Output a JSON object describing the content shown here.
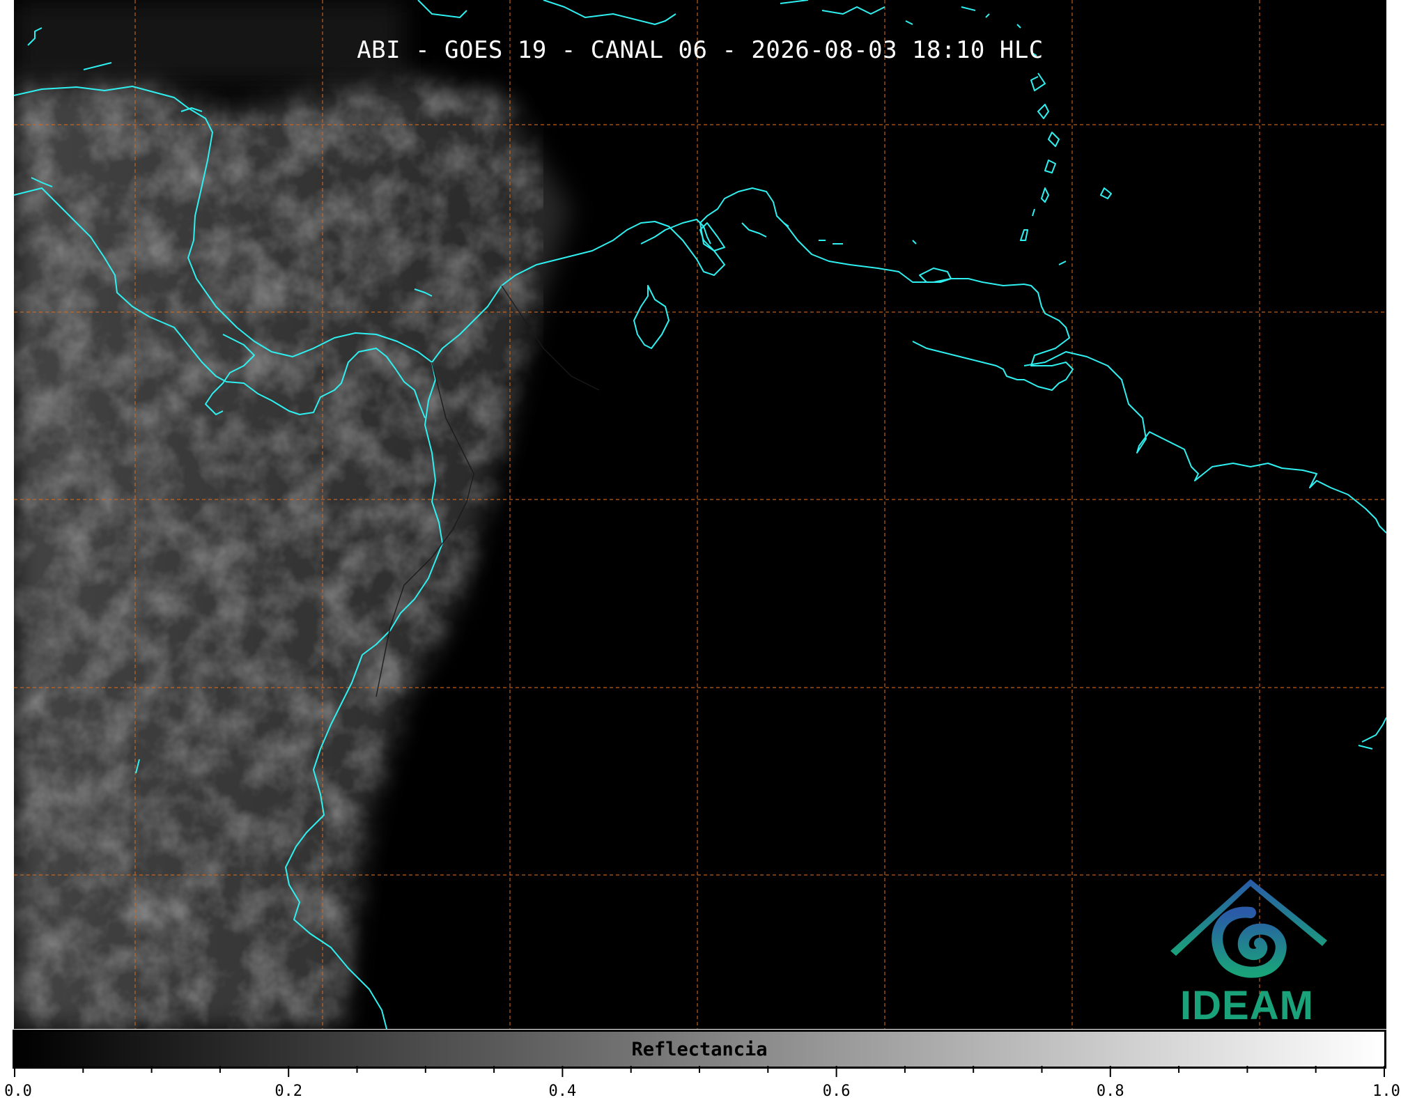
{
  "title": "ABI - GOES 19 - CANAL 06 - 2026-08-03 18:10 HLC",
  "logo": {
    "text": "IDEAM",
    "color": "#1aa37a",
    "icon": "ideam-spiral-mountain-logo"
  },
  "colorbar": {
    "label": "Reflectancia",
    "range": [
      0.0,
      1.0
    ],
    "colormap": "greys",
    "tick_labels": [
      "0.0",
      "0.2",
      "0.4",
      "0.6",
      "0.8",
      "1.0"
    ],
    "minor_tick_count": 21
  },
  "map": {
    "background_color": "#000000",
    "coastline_color": "#2ff0f0",
    "gridline_color": "#d2691e",
    "gridline_style": "dashed",
    "grid": true
  }
}
